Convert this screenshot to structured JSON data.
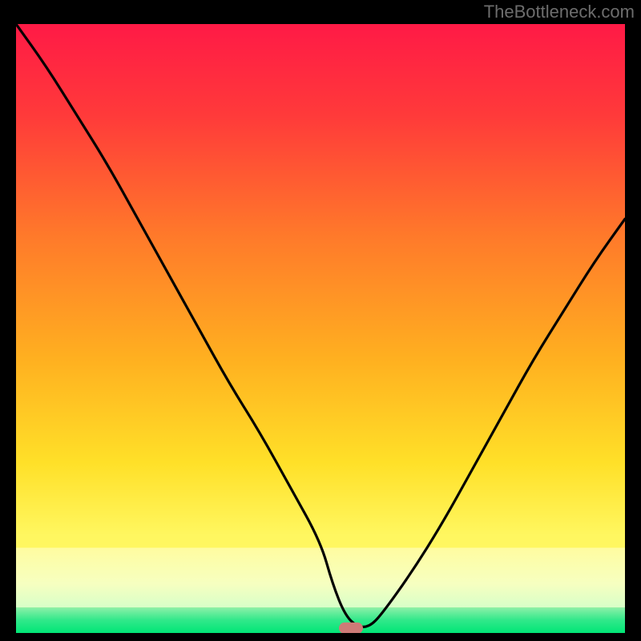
{
  "attribution": "TheBottleneck.com",
  "chart_data": {
    "type": "line",
    "title": "",
    "xlabel": "",
    "ylabel": "",
    "xlim": [
      0,
      100
    ],
    "ylim": [
      0,
      100
    ],
    "series": [
      {
        "name": "curve",
        "x": [
          0,
          5,
          10,
          15,
          20,
          25,
          30,
          35,
          40,
          45,
          50,
          52,
          54,
          56,
          58,
          60,
          65,
          70,
          75,
          80,
          85,
          90,
          95,
          100
        ],
        "y": [
          100,
          93,
          85,
          77,
          68,
          59,
          50,
          41,
          33,
          24,
          15,
          8,
          3,
          1,
          1,
          3,
          10,
          18,
          27,
          36,
          45,
          53,
          61,
          68
        ]
      }
    ],
    "marker": {
      "x": 55,
      "y": 0.8
    },
    "green_band_top": 4.2,
    "yellow_band_top": 14
  }
}
